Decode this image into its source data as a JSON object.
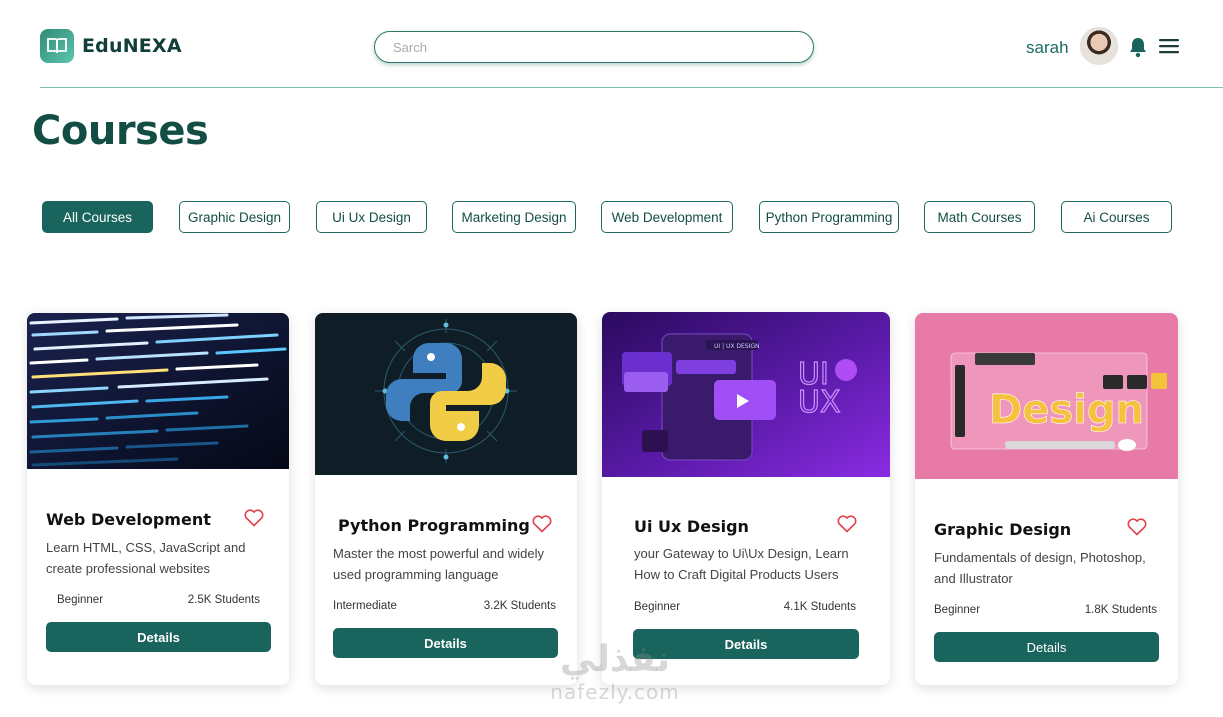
{
  "brand": {
    "name": "EduNEXA",
    "logo_icon": "open-book-icon",
    "accent": "#19645c"
  },
  "search": {
    "placeholder": "Sarch"
  },
  "user": {
    "name": "sarah"
  },
  "page": {
    "title": "Courses"
  },
  "filters": [
    {
      "label": "All Courses",
      "active": true
    },
    {
      "label": "Graphic Design",
      "active": false
    },
    {
      "label": "Ui Ux Design",
      "active": false
    },
    {
      "label": "Marketing Design",
      "active": false
    },
    {
      "label": "Web Development",
      "active": false
    },
    {
      "label": "Python Programming",
      "active": false
    },
    {
      "label": "Math Courses",
      "active": false
    },
    {
      "label": "Ai Courses",
      "active": false
    }
  ],
  "courses": [
    {
      "title": "Web Development",
      "description": "Learn HTML, CSS, JavaScript and create professional websites",
      "level": "Beginner",
      "students": "2.5K Students",
      "button": "Details"
    },
    {
      "title": "Python Programming",
      "description": "Master the most powerful and widely used programming language",
      "level": "Intermediate",
      "students": "3.2K Students",
      "button": "Details"
    },
    {
      "title": "Ui Ux  Design",
      "description": "your Gateway to Ui\\Ux Design, Learn How to Craft Digital Products Users",
      "level": "Beginner",
      "students": "4.1K Students",
      "button": "Details",
      "image_text": {
        "tag": "UI | UX DESIGN",
        "big_1": "UI",
        "big_2": "UX"
      }
    },
    {
      "title": "Graphic Design",
      "description": "Fundamentals of design, Photoshop, and Illustrator",
      "level": "Beginner",
      "students": "1.8K Students",
      "button": "Details",
      "image_text": {
        "word": "Design"
      }
    }
  ],
  "watermark": {
    "arabic": "نفذلي",
    "latin": "nafezly.com"
  }
}
